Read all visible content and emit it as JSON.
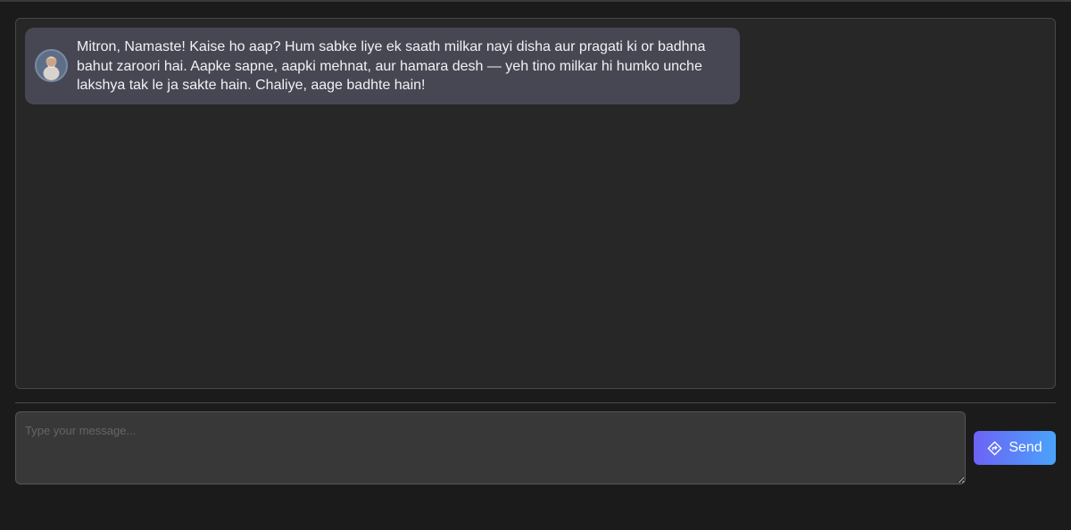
{
  "chat": {
    "messages": [
      {
        "sender": "assistant",
        "avatar_icon": "person-avatar-icon",
        "text": "Mitron, Namaste! Kaise ho aap? Hum sabke liye ek saath milkar nayi disha aur pragati ki or badhna bahut zaroori hai. Aapke sapne, aapki mehnat, aur hamara desh — yeh tino milkar hi humko unche lakshya tak le ja sakte hain. Chaliye, aage badhte hain!"
      }
    ]
  },
  "composer": {
    "placeholder": "Type your message...",
    "value": "",
    "send_label": "Send",
    "send_icon": "navigation-diamond-icon"
  },
  "colors": {
    "background": "#1b1b1b",
    "panel": "#272727",
    "bubble": "#474754",
    "input": "#383838",
    "send_gradient_start": "#6c63f5",
    "send_gradient_end": "#4aa3fb"
  }
}
